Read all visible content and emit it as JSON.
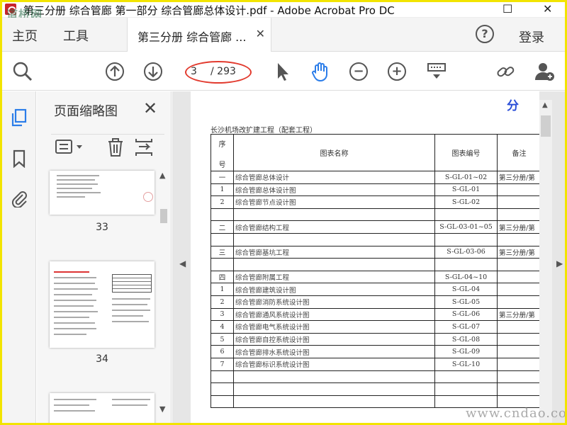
{
  "window": {
    "title": "第三分册 综合管廊 第一部分 综合管廊总体设计.pdf - Adobe Acrobat Pro DC",
    "watermark_top": "道桥网"
  },
  "tabs": {
    "home": "主页",
    "tools": "工具",
    "doc_tab": "第三分册 综合管廊 ...",
    "signin": "登录"
  },
  "toolbar": {
    "current_page": "3",
    "total_pages": "/ 293"
  },
  "thumbnails": {
    "title": "页面缩略图",
    "pages": [
      "33",
      "34"
    ]
  },
  "document": {
    "corner_mark": "分",
    "project": "长沙机场改扩建工程（配套工程）",
    "headers": {
      "seq": [
        "序",
        "号"
      ],
      "name": "图表名称",
      "code": "图表编号",
      "note": "备注"
    },
    "rows": [
      {
        "seq": "一",
        "name": "综合管廊总体设计",
        "code": "S-GL-01~02",
        "note": "第三分册/第"
      },
      {
        "seq": "1",
        "name": "综合管廊总体设计图",
        "code": "S-GL-01",
        "note": ""
      },
      {
        "seq": "2",
        "name": "综合管廊节点设计图",
        "code": "S-GL-02",
        "note": ""
      },
      {
        "seq": "",
        "name": "",
        "code": "",
        "note": ""
      },
      {
        "seq": "二",
        "name": "综合管廊结构工程",
        "code": "S-GL-03-01~05",
        "note": "第三分册/第"
      },
      {
        "seq": "",
        "name": "",
        "code": "",
        "note": ""
      },
      {
        "seq": "三",
        "name": "综合管廊基坑工程",
        "code": "S-GL-03-06",
        "note": "第三分册/第"
      },
      {
        "seq": "",
        "name": "",
        "code": "",
        "note": ""
      },
      {
        "seq": "四",
        "name": "综合管廊附属工程",
        "code": "S-GL-04~10",
        "note": ""
      },
      {
        "seq": "1",
        "name": "综合管廊建筑设计图",
        "code": "S-GL-04",
        "note": ""
      },
      {
        "seq": "2",
        "name": "综合管廊消防系统设计图",
        "code": "S-GL-05",
        "note": ""
      },
      {
        "seq": "3",
        "name": "综合管廊通风系统设计图",
        "code": "S-GL-06",
        "note": "第三分册/第"
      },
      {
        "seq": "4",
        "name": "综合管廊电气系统设计图",
        "code": "S-GL-07",
        "note": ""
      },
      {
        "seq": "5",
        "name": "综合管廊自控系统设计图",
        "code": "S-GL-08",
        "note": ""
      },
      {
        "seq": "6",
        "name": "综合管廊排水系统设计图",
        "code": "S-GL-09",
        "note": ""
      },
      {
        "seq": "7",
        "name": "综合管廊标识系统设计图",
        "code": "S-GL-10",
        "note": ""
      },
      {
        "seq": "",
        "name": "",
        "code": "",
        "note": ""
      },
      {
        "seq": "",
        "name": "",
        "code": "",
        "note": ""
      },
      {
        "seq": "",
        "name": "",
        "code": "",
        "note": ""
      }
    ]
  },
  "bottom_watermark": "www.cndao.com",
  "colors": {
    "frame": "#f2e400",
    "accent_blue": "#2b7de9",
    "annotation_red": "#e23a2e"
  }
}
